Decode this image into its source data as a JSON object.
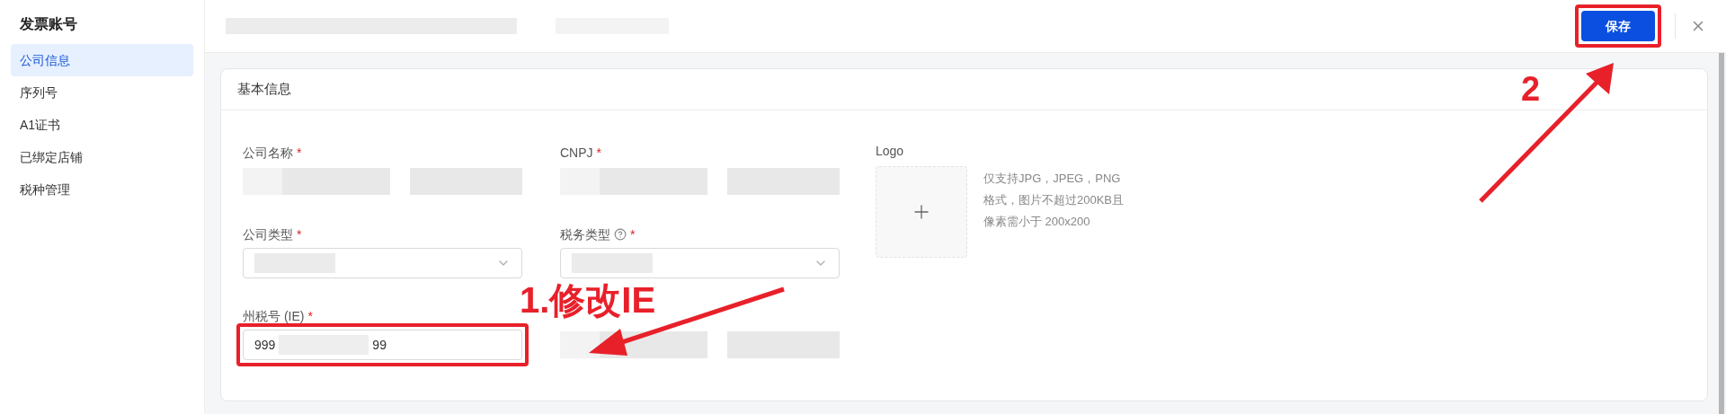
{
  "sidebar": {
    "title": "发票账号",
    "items": [
      {
        "label": "公司信息",
        "selected": true
      },
      {
        "label": "序列号",
        "selected": false
      },
      {
        "label": "A1证书",
        "selected": false
      },
      {
        "label": "已绑定店铺",
        "selected": false
      },
      {
        "label": "税种管理",
        "selected": false
      }
    ]
  },
  "header": {
    "save_button": {
      "label": "保存",
      "highlighted": true
    }
  },
  "section": {
    "title": "基本信息",
    "fields": [
      {
        "kind": "text",
        "label": "公司名称",
        "required_mark": "*"
      },
      {
        "kind": "text",
        "label": "CNPJ",
        "required_mark": "*"
      },
      {
        "kind": "select",
        "label": "公司类型",
        "required_mark": "*"
      },
      {
        "kind": "select",
        "label": "税务类型",
        "required_mark": "*",
        "help": true
      },
      {
        "kind": "input",
        "label": "州税号 (IE)",
        "required_mark": "*",
        "value_start": "999",
        "value_end": "99",
        "highlighted": true
      },
      {
        "kind": "text"
      }
    ],
    "logo": {
      "label": "Logo",
      "hint": [
        "仅支持JPG，JPEG，PNG",
        "格式，图片不超过200KB且",
        "像素需小于 200x200"
      ]
    }
  },
  "annotations": {
    "step_1": "1.修改IE",
    "step_2": "2"
  }
}
